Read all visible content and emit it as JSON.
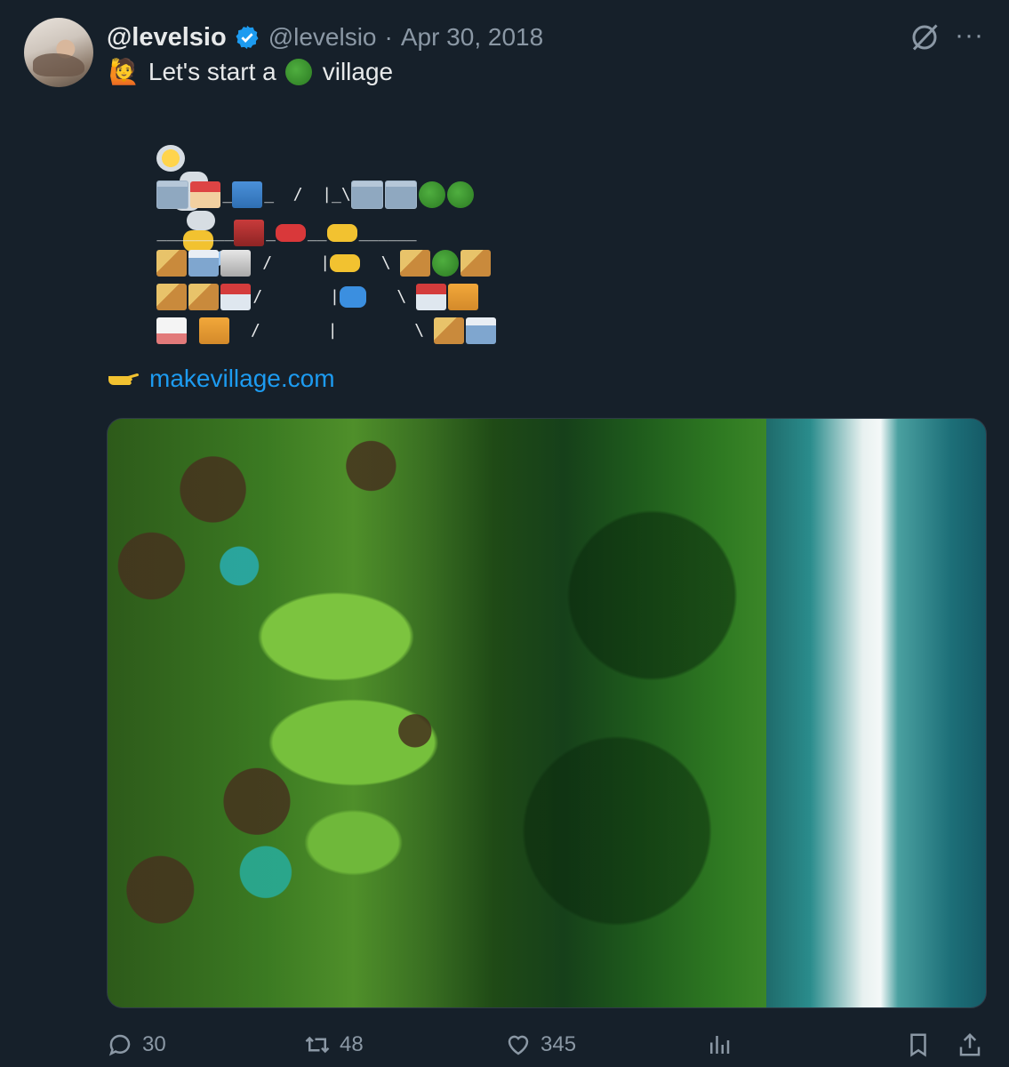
{
  "tweet": {
    "display_name": "@levelsio",
    "handle": "@levelsio",
    "separator": "·",
    "date": "Apr 30, 2018",
    "text_before": "Let's start a",
    "text_after": "village",
    "link_text": "makevillage.com",
    "ascii_art": {
      "row2_a": "_",
      "row2_b": "_  /  |_\\",
      "row3_line": "________",
      "row3_mid": "_",
      "row3_b": "__",
      "row3_c": "______",
      "row4_a": " /     |",
      "row4_b": "  \\ ",
      "row5_a": "/       |",
      "row5_b": "   \\ ",
      "row6_a": "  /       |        \\ "
    }
  },
  "actions": {
    "replies": "30",
    "reposts": "48",
    "likes": "345"
  },
  "icons": {
    "verified": "verified-badge-icon",
    "grok": "grok-icon",
    "more": "more-icon",
    "reply": "reply-icon",
    "repost": "repost-icon",
    "like": "heart-icon",
    "views": "views-icon",
    "bookmark": "bookmark-icon",
    "share": "share-icon"
  },
  "colors": {
    "background": "#16202a",
    "link": "#1d9bf0",
    "muted": "#8b98a5",
    "text": "#e7e9ea"
  }
}
